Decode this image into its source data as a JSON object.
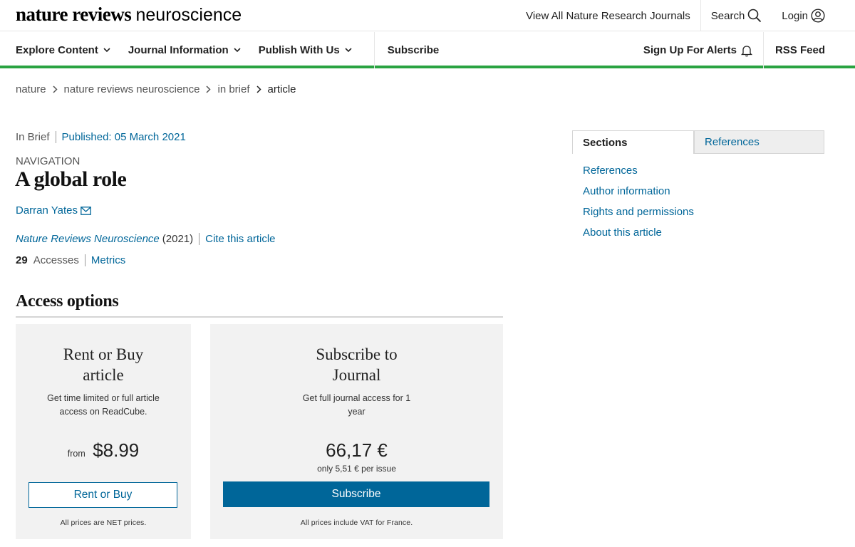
{
  "header": {
    "brand_bold": "nature reviews",
    "brand_light": "neuroscience",
    "view_all": "View All Nature Research Journals",
    "search": "Search",
    "login": "Login"
  },
  "nav": {
    "items": [
      "Explore Content",
      "Journal Information",
      "Publish With Us",
      "Subscribe"
    ],
    "alerts": "Sign Up For Alerts",
    "rss": "RSS Feed"
  },
  "breadcrumb": [
    "nature",
    "nature reviews neuroscience",
    "in brief",
    "article"
  ],
  "article": {
    "type": "In Brief",
    "published": "Published: 05 March 2021",
    "subject": "NAVIGATION",
    "title": "A global role",
    "author": "Darran Yates",
    "journal": "Nature Reviews Neuroscience",
    "year": "(2021)",
    "cite": "Cite this article",
    "accesses_count": "29",
    "accesses_label": "Accesses",
    "metrics": "Metrics"
  },
  "access": {
    "heading": "Access options",
    "rent": {
      "title_line1": "Rent or Buy",
      "title_line2": "article",
      "desc": "Get time limited or full article access on ReadCube.",
      "from": "from",
      "price": "$8.99",
      "button": "Rent or Buy",
      "footnote": "All prices are NET prices."
    },
    "subscribe": {
      "title_line1": "Subscribe to",
      "title_line2": "Journal",
      "desc": "Get full journal access for 1 year",
      "price": "66,17 €",
      "per_issue": "only 5,51 € per issue",
      "button": "Subscribe",
      "footnote": "All prices include VAT for France."
    }
  },
  "sidebar": {
    "tab_sections": "Sections",
    "tab_references": "References",
    "links": [
      "References",
      "Author information",
      "Rights and permissions",
      "About this article"
    ]
  },
  "colors": {
    "link": "#006699",
    "accent_green": "#29a341",
    "button_blue": "#006699",
    "card_bg": "#f2f2f2"
  }
}
